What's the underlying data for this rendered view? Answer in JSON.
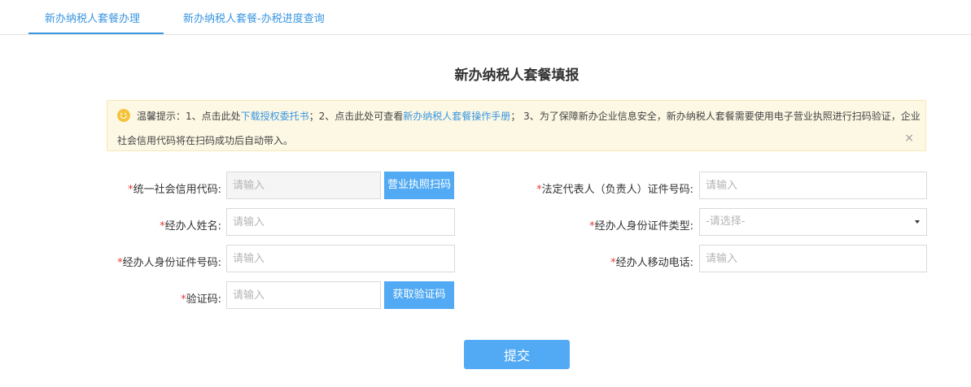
{
  "tabs": [
    {
      "label": "新办纳税人套餐办理"
    },
    {
      "label": "新办纳税人套餐-办税进度查询"
    }
  ],
  "title": "新办纳税人套餐填报",
  "notice": {
    "prefix": "温馨提示：1、点击此处",
    "link1": "下载授权委托书",
    "mid1": "；2、点击此处可查看",
    "link2": "新办纳税人套餐操作手册",
    "mid2": "；  3、为了保障新办企业信息安全，新办纳税人套餐需要使用电子营业执照进行扫码验证，企业",
    "line2": "社会信用代码将在扫码成功后自动带入。",
    "close": "×"
  },
  "form": {
    "required_mark": "*",
    "credit_code": {
      "label": "统一社会信用代码:",
      "placeholder": "请输入",
      "button": "营业执照扫码"
    },
    "legal_id": {
      "label": "法定代表人（负责人）证件号码:",
      "placeholder": "请输入"
    },
    "agent_name": {
      "label": "经办人姓名:",
      "placeholder": "请输入"
    },
    "agent_id_type": {
      "label": "经办人身份证件类型:",
      "placeholder": "-请选择-"
    },
    "agent_id_no": {
      "label": "经办人身份证件号码:",
      "placeholder": "请输入"
    },
    "agent_phone": {
      "label": "经办人移动电话:",
      "placeholder": "请输入"
    },
    "captcha": {
      "label": "验证码:",
      "placeholder": "请输入",
      "button": "获取验证码"
    }
  },
  "submit_label": "提交",
  "colors": {
    "accent": "#51aaf3",
    "link": "#3a95e0",
    "required": "#e23c3c",
    "notice_bg": "#fdf8e4"
  }
}
